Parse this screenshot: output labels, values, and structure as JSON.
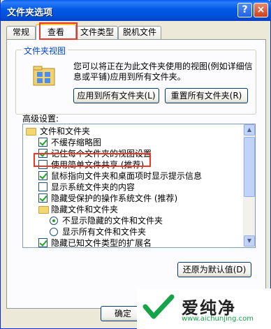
{
  "window": {
    "title": "文件夹选项",
    "help": "?",
    "close": "×"
  },
  "tabs": [
    {
      "label": "常规"
    },
    {
      "label": "查看"
    },
    {
      "label": "文件类型"
    },
    {
      "label": "脱机文件"
    }
  ],
  "folder_view": {
    "title": "文件夹视图",
    "desc": "您可以将正在为此文件夹使用的视图(例如详细信息或平铺)应用到所有文件夹。",
    "apply_btn": "应用到所有文件夹(L)",
    "reset_btn": "重置所有文件夹(R)"
  },
  "advanced": {
    "label": "高级设置:",
    "items": [
      {
        "type": "folder",
        "text": "文件和文件夹"
      },
      {
        "type": "check",
        "checked": true,
        "text": "不缓存缩略图"
      },
      {
        "type": "check",
        "checked": true,
        "text": "记住每个文件夹的视图设置"
      },
      {
        "type": "check",
        "checked": false,
        "text": "使用简单文件共享 (推荐)"
      },
      {
        "type": "check",
        "checked": true,
        "text": "鼠标指向文件夹和桌面项时显示提示信息"
      },
      {
        "type": "check",
        "checked": false,
        "text": "显示系统文件夹的内容"
      },
      {
        "type": "check",
        "checked": true,
        "text": "隐藏受保护的操作系统文件 (推荐)"
      },
      {
        "type": "folder",
        "text": "隐藏文件和文件夹"
      },
      {
        "type": "radio",
        "checked": true,
        "text": "不显示隐藏的文件和文件夹"
      },
      {
        "type": "radio",
        "checked": false,
        "text": "显示所有文件和文件夹"
      },
      {
        "type": "check",
        "checked": true,
        "text": "隐藏已知文件类型的扩展名"
      }
    ]
  },
  "restore_btn": "还原为默认值(D)",
  "ok_btn": "确定",
  "watermark": {
    "brand": "爱纯净",
    "url": "www.aichunjing.com"
  }
}
